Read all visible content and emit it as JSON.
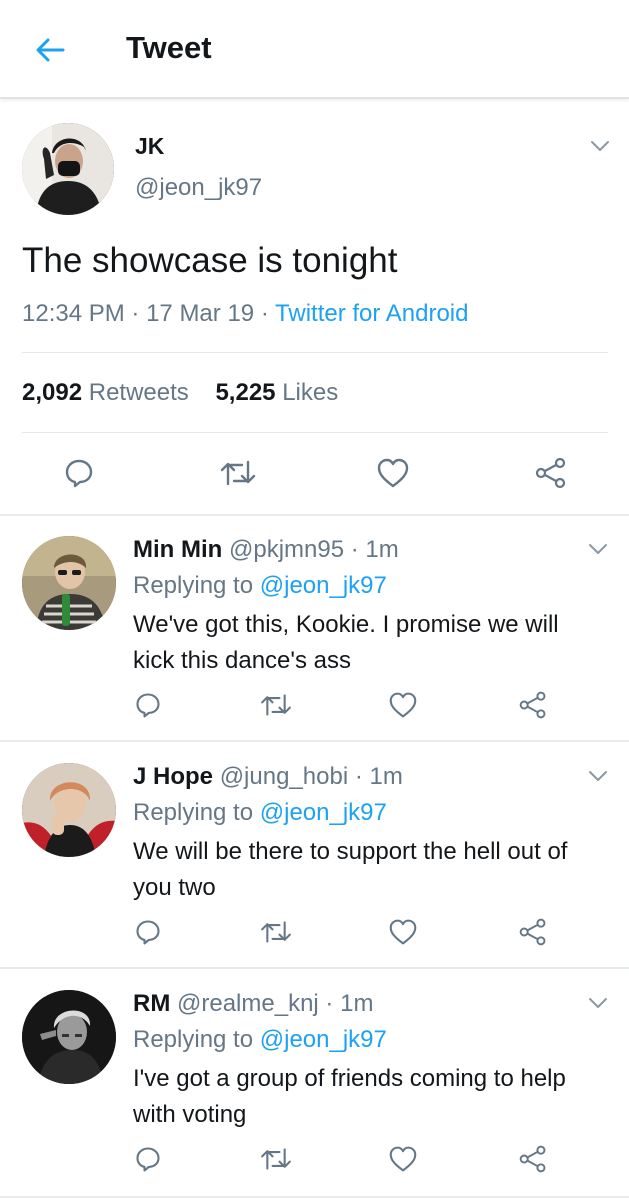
{
  "header": {
    "title": "Tweet",
    "back_icon": "arrow-left-icon",
    "accent": "#1da1f2"
  },
  "main_tweet": {
    "author_name": "JK",
    "author_handle": "@jeon_jk97",
    "text": "The showcase is tonight",
    "time": "12:34 PM",
    "date": "17 Mar 19",
    "source": "Twitter for Android",
    "retweet_count": "2,092",
    "retweet_label": "Retweets",
    "like_count": "5,225",
    "like_label": "Likes",
    "actions": [
      "reply-icon",
      "retweet-icon",
      "like-icon",
      "share-icon"
    ]
  },
  "replies": [
    {
      "name": "Min Min",
      "handle": "@pkjmn95",
      "age": "1m",
      "replying_prefix": "Replying to",
      "replying_to": "@jeon_jk97",
      "text_line1": "We've got this, Kookie. I promise we will",
      "text_line2": "kick this dance's ass"
    },
    {
      "name": "J Hope",
      "handle": "@jung_hobi",
      "age": "1m",
      "replying_prefix": "Replying to",
      "replying_to": "@jeon_jk97",
      "text_line1": "We will be there to support the hell out of",
      "text_line2": "you two"
    },
    {
      "name": "RM",
      "handle": "@realme_knj",
      "age": "1m",
      "replying_prefix": "Replying to",
      "replying_to": "@jeon_jk97",
      "text_line1": "I've got a group of friends coming to help",
      "text_line2": "with voting"
    }
  ],
  "colors": {
    "text": "#14171a",
    "secondary": "#657786",
    "link": "#1da1f2",
    "divider": "#e6ecf0"
  }
}
